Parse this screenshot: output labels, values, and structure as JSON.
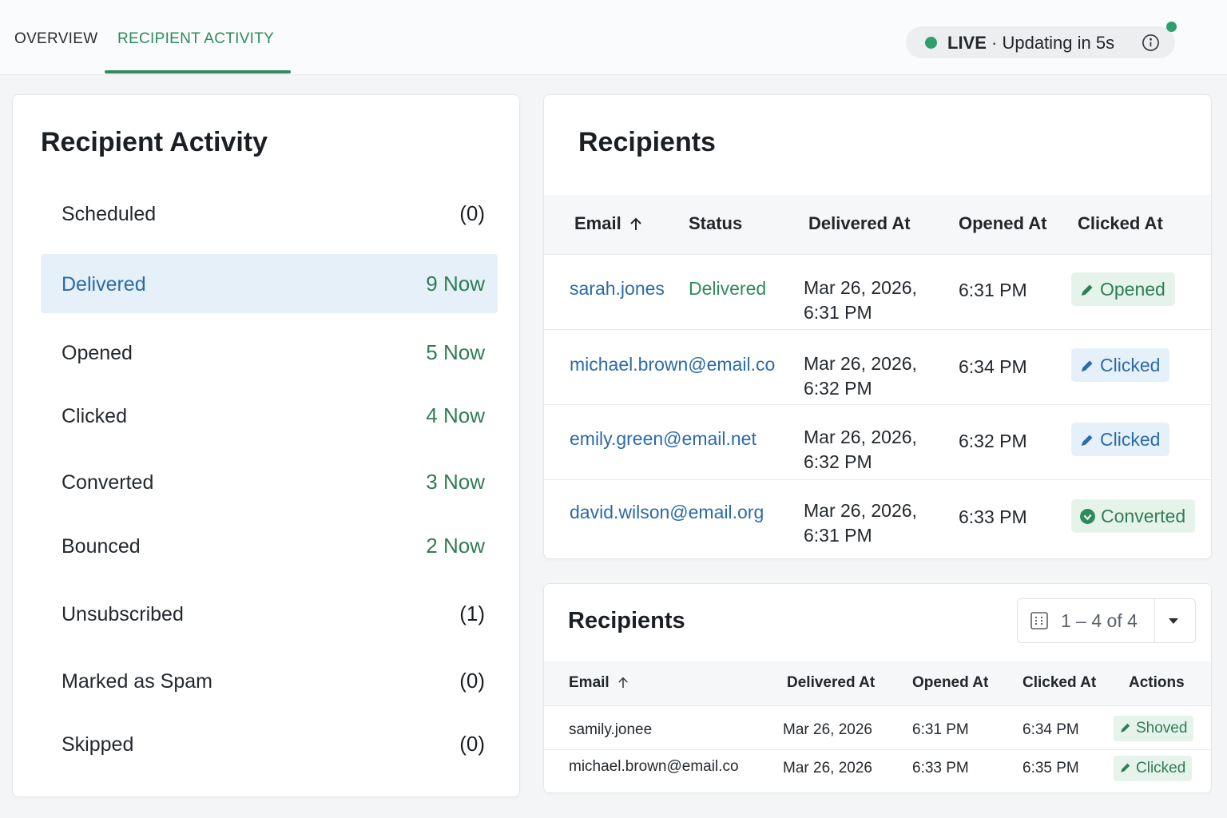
{
  "nav": {
    "tabs": [
      {
        "label": "OVERVIEW",
        "active": false
      },
      {
        "label": "RECIPIENT ACTIVITY",
        "active": true
      }
    ],
    "live": {
      "label": "LIVE",
      "status": " · Updating in 5s"
    }
  },
  "activity": {
    "title": "Recipient Activity",
    "items": [
      {
        "label": "Scheduled",
        "count": "(0)"
      },
      {
        "label": "Delivered",
        "count": "9 Now",
        "selected": true
      },
      {
        "label": "Opened",
        "count": "5 Now"
      },
      {
        "label": "Clicked",
        "count": "4 Now"
      },
      {
        "label": "Converted",
        "count": "3 Now"
      },
      {
        "label": "Bounced",
        "count": "2 Now"
      },
      {
        "label": "Unsubscribed",
        "count": "(1)"
      },
      {
        "label": "Marked as Spam",
        "count": "(0)"
      },
      {
        "label": "Skipped",
        "count": "(0)"
      }
    ]
  },
  "recipients_main": {
    "title": "Recipients",
    "columns": [
      "Email",
      "Status",
      "Delivered At",
      "Opened At",
      "Clicked At"
    ],
    "rows": [
      {
        "email": "sarah.jones",
        "status": "Delivered",
        "delivered_line1": "Mar 26, 2026,",
        "delivered_line2": "6:31 PM",
        "opened": "6:31 PM",
        "badge": "Opened",
        "badge_color": "green",
        "badge_icon": "pencil-icon"
      },
      {
        "email": "michael.brown@email.co",
        "status": "",
        "delivered_line1": "Mar 26, 2026,",
        "delivered_line2": "6:32 PM",
        "opened": "6:34 PM",
        "badge": "Clicked",
        "badge_color": "blue",
        "badge_icon": "pencil-icon"
      },
      {
        "email": "emily.green@email.net",
        "status": "",
        "delivered_line1": "Mar 26, 2026,",
        "delivered_line2": "6:32 PM",
        "opened": "6:32 PM",
        "badge": "Clicked",
        "badge_color": "blue",
        "badge_icon": "pencil-icon"
      },
      {
        "email": "david.wilson@email.org",
        "status": "",
        "delivered_line1": "Mar 26, 2026,",
        "delivered_line2": "6:31 PM",
        "opened": "6:33 PM",
        "badge": "Converted",
        "badge_color": "green",
        "badge_icon": "check-circle-icon"
      }
    ]
  },
  "recipients_secondary": {
    "title": "Recipients",
    "pagination": "1 – 4 of 4",
    "columns": [
      "Email",
      "Delivered At",
      "Opened At",
      "Clicked At",
      "Actions"
    ],
    "rows": [
      {
        "email": "samily.jonee",
        "delivered": "Mar 26, 2026",
        "opened": "6:31 PM",
        "clicked": "6:34 PM",
        "action": "Shoved"
      },
      {
        "email": "michael.brown@email.co",
        "delivered": "Mar 26, 2026",
        "opened": "6:33 PM",
        "clicked": "6:35 PM",
        "action": "Clicked"
      }
    ]
  },
  "colors": {
    "accent_green": "#2f8a5d",
    "link_blue": "#2a6ba8",
    "selected_row": "#e6f0f9",
    "live_dot": "#2f9e6a"
  }
}
